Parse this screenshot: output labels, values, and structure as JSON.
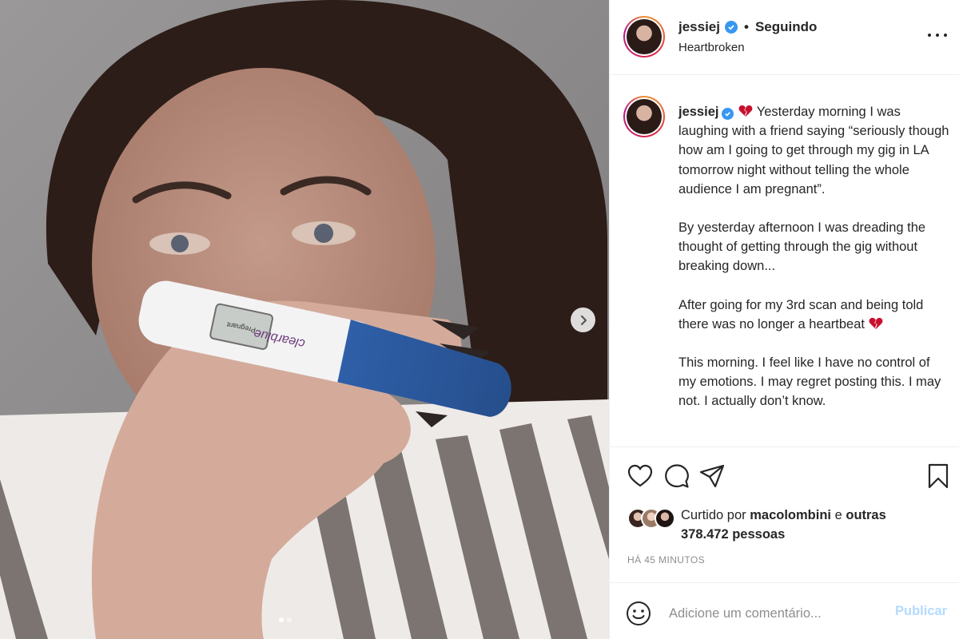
{
  "header": {
    "username": "jessiej",
    "separator": "•",
    "follow_label": "Seguindo",
    "location": "Heartbroken"
  },
  "caption": {
    "username": "jessiej",
    "paragraphs": [
      "Yesterday morning I was laughing with a friend saying “seriously though how am I going to get through my gig in LA tomorrow night without telling the whole audience I am pregnant”.",
      "By yesterday afternoon I was dreading the thought of getting through the gig without breaking down...",
      "After going for my 3rd scan and being told there was no longer a heartbeat",
      "This morning. I feel like I have no control of my emotions. I may regret posting this. I may not. I actually don’t know."
    ]
  },
  "likes": {
    "prefix": "Curtido por",
    "user": "macolombini",
    "joiner": "e",
    "others": "outras 378.472 pessoas"
  },
  "timestamp": "HÁ 45 MINUTOS",
  "comment": {
    "placeholder": "Adicione um comentário...",
    "publish_label": "Publicar"
  },
  "carousel": {
    "total": 2,
    "current": 1
  },
  "photo": {
    "test_brand": "clearblue",
    "test_display": "Pregnant"
  },
  "colors": {
    "verified": "#3897f0",
    "publish_disabled": "#b3dbff",
    "border": "#efefef",
    "muted": "#8e8e8e"
  },
  "icons": [
    "chevron-right-icon",
    "verified-icon",
    "more-icon",
    "heart-icon",
    "comment-icon",
    "share-icon",
    "bookmark-icon",
    "emoji-icon",
    "broken-heart-icon"
  ]
}
